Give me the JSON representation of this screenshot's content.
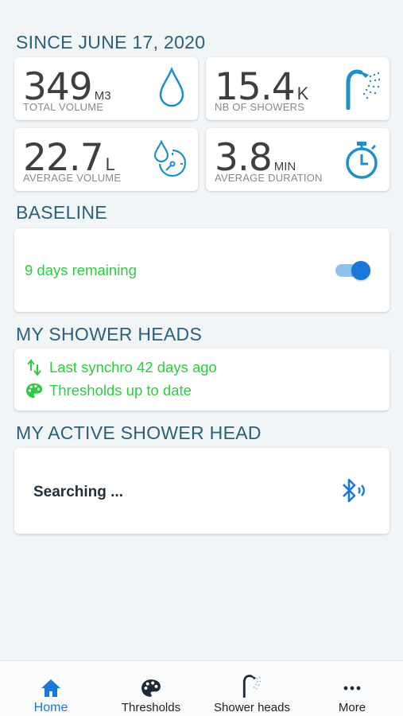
{
  "colors": {
    "accent": "#1a78d8",
    "success": "#2ecc40",
    "title": "#2b5f7a",
    "icon": "#1f8fc7"
  },
  "summary": {
    "title": "SINCE JUNE 17, 2020",
    "stats": [
      {
        "value": "349",
        "unit": "M3",
        "label": "TOTAL VOLUME",
        "icon": "water-drop-icon"
      },
      {
        "value": "15.4",
        "unit": "K",
        "label": "NB OF SHOWERS",
        "icon": "shower-head-icon"
      },
      {
        "value": "22.7",
        "unit": "L",
        "label": "AVERAGE VOLUME",
        "icon": "drop-gauge-icon"
      },
      {
        "value": "3.8",
        "unit": "MIN",
        "label": "AVERAGE DURATION",
        "icon": "stopwatch-icon"
      }
    ]
  },
  "baseline": {
    "title": "BASELINE",
    "status": "9 days remaining",
    "toggle_on": true
  },
  "shower_heads": {
    "title": "MY SHOWER HEADS",
    "sync": "Last synchro 42 days ago",
    "thresholds": "Thresholds up to date"
  },
  "active_head": {
    "title": "MY ACTIVE SHOWER HEAD",
    "status": "Searching ...",
    "icon": "bluetooth-searching-icon"
  },
  "tabs": [
    {
      "label": "Home",
      "icon": "home-icon",
      "active": true
    },
    {
      "label": "Thresholds",
      "icon": "palette-icon",
      "active": false
    },
    {
      "label": "Shower heads",
      "icon": "shower-head-icon",
      "active": false
    },
    {
      "label": "More",
      "icon": "more-dots-icon",
      "active": false
    }
  ]
}
